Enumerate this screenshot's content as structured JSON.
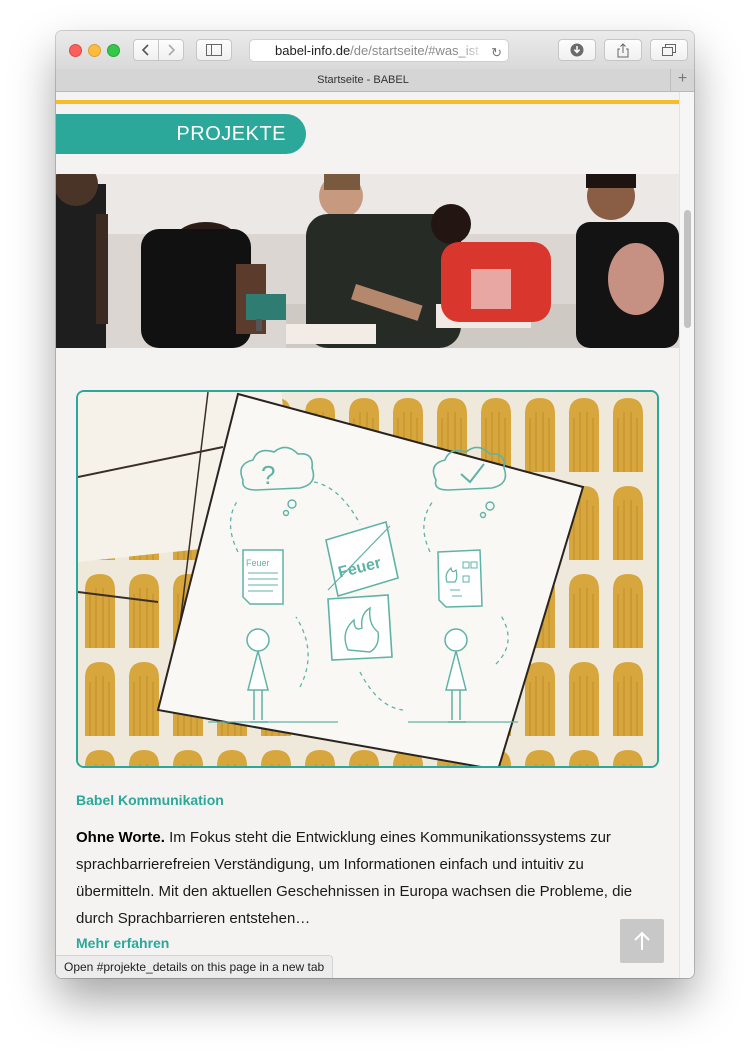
{
  "browser": {
    "url_domain": "babel-info.de",
    "url_path": "/de/startseite/#was_ist",
    "tab_title": "Startseite - BABEL",
    "status_text": "Open #projekte_details on this page in a new tab"
  },
  "page": {
    "section_title": "PROJEKTE",
    "project": {
      "title": "Babel Kommunikation",
      "lead": "Ohne Worte.",
      "description": "Im Fokus steht die Entwicklung eines Kommunikationssystems zur sprachbarrierefreien Verständigung, um Informationen einfach und intuitiv zu übermitteln. Mit den aktuellen Geschehnissen in Europa wachsen die Probleme, die durch Sprachbarrieren entstehen…",
      "more_label": "Mehr erfahren",
      "illustration": {
        "question_mark": "?",
        "card_word": "Feuer",
        "doc_label": "Feuer"
      }
    }
  },
  "colors": {
    "accent": "#2ba89a",
    "yellow_bar": "#f5bd2c"
  }
}
